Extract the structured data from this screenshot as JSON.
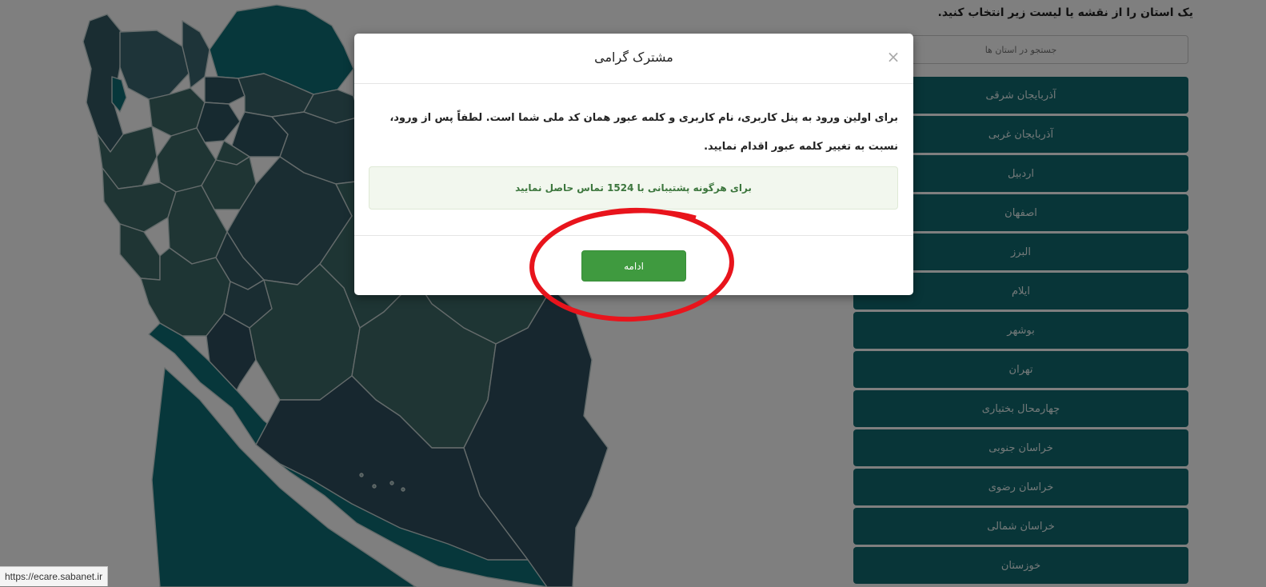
{
  "panel": {
    "title": "یک استان را از نقشه یا لیست زیر انتخاب کنید.",
    "search_placeholder": "جستجو در استان ها",
    "provinces": [
      "آذربایجان شرقی",
      "آذربایجان غربی",
      "اردبیل",
      "اصفهان",
      "البرز",
      "ایلام",
      "بوشهر",
      "تهران",
      "چهارمحال بختیاری",
      "خراسان جنوبی",
      "خراسان رضوی",
      "خراسان شمالی",
      "خوزستان"
    ]
  },
  "modal": {
    "title": "مشترک گرامی",
    "close_symbol": "×",
    "body": "برای اولین ورود به پنل کاربری، نام کاربری و کلمه عبور همان کد ملی شما است. لطفاً پس از ورود، نسبت به تغییر کلمه عبور اقدام نمایید.",
    "alert": "برای هرگونه پشتیبانی با 1524 تماس حاصل نمایید",
    "continue_label": "ادامه"
  },
  "status_bar": {
    "url": "https://ecare.sabanet.ir"
  },
  "colors": {
    "province_button": "#116b70",
    "continue_button": "#3f9a3f",
    "alert_text": "#3c763d",
    "annotation": "#e8141c"
  }
}
